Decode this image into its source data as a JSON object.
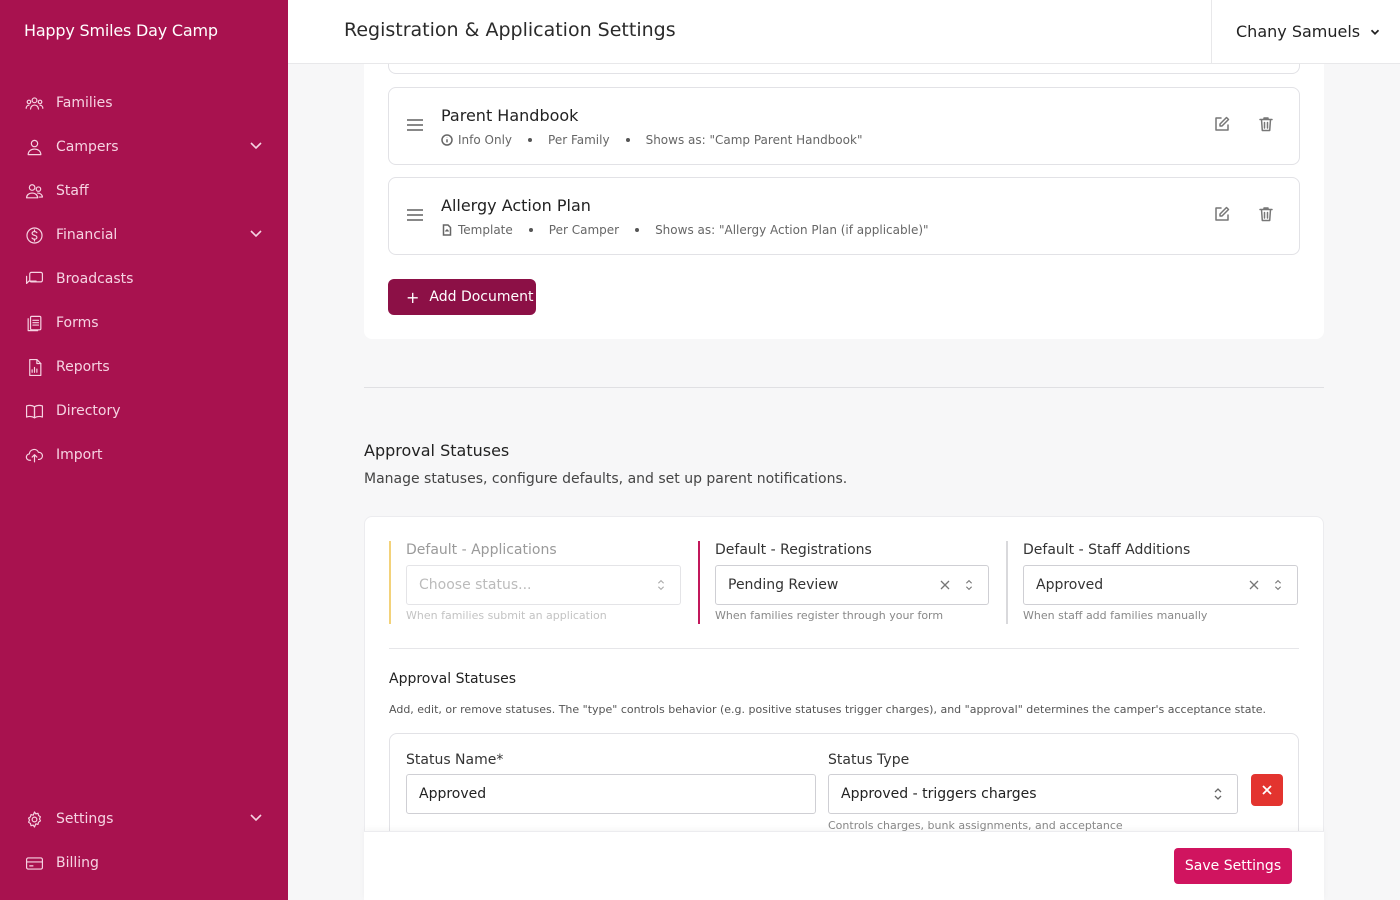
{
  "brand": {
    "name": "Happy Smiles Day Camp",
    "accent": "#a8124f"
  },
  "sidebar": {
    "items": [
      {
        "label": "Families",
        "icon": "families-icon",
        "expandable": false
      },
      {
        "label": "Campers",
        "icon": "camper-icon",
        "expandable": true
      },
      {
        "label": "Staff",
        "icon": "staff-icon",
        "expandable": false
      },
      {
        "label": "Financial",
        "icon": "dollar-icon",
        "expandable": true
      },
      {
        "label": "Broadcasts",
        "icon": "chat-icon",
        "expandable": false
      },
      {
        "label": "Forms",
        "icon": "forms-icon",
        "expandable": false
      },
      {
        "label": "Reports",
        "icon": "report-icon",
        "expandable": false
      },
      {
        "label": "Directory",
        "icon": "book-icon",
        "expandable": false
      },
      {
        "label": "Import",
        "icon": "upload-cloud-icon",
        "expandable": false
      }
    ],
    "bottom_items": [
      {
        "label": "Settings",
        "icon": "gear-icon",
        "expandable": true
      },
      {
        "label": "Billing",
        "icon": "card-icon",
        "expandable": false
      }
    ]
  },
  "header": {
    "title": "Registration & Application Settings",
    "user_name": "Chany Samuels"
  },
  "documents": [
    {
      "title": "Parent Handbook",
      "type_icon": "info-icon",
      "type": "Info Only",
      "scope": "Per Family",
      "shows_as": "Shows as: \"Camp Parent Handbook\""
    },
    {
      "title": "Allergy Action Plan",
      "type_icon": "file-icon",
      "type": "Template",
      "scope": "Per Camper",
      "shows_as": "Shows as: \"Allergy Action Plan (if applicable)\""
    }
  ],
  "add_document_label": "Add Document",
  "approval": {
    "title": "Approval Statuses",
    "subtitle": "Manage statuses, configure defaults, and set up parent notifications.",
    "defaults": [
      {
        "label": "Default - Applications",
        "value": "",
        "placeholder": "Choose status...",
        "hint": "When families submit an application",
        "disabled": true,
        "bar_color": "#f3d27a"
      },
      {
        "label": "Default - Registrations",
        "value": "Pending Review",
        "placeholder": "",
        "hint": "When families register through your form",
        "disabled": false,
        "bar_color": "#c2185b"
      },
      {
        "label": "Default - Staff Additions",
        "value": "Approved",
        "placeholder": "",
        "hint": "When staff add families manually",
        "disabled": false,
        "bar_color": "#d9d9dc"
      }
    ],
    "statuses_title": "Approval Statuses",
    "statuses_desc": "Add, edit, or remove statuses. The \"type\" controls behavior (e.g. positive statuses trigger charges), and \"approval\" determines the camper's acceptance state.",
    "status_row": {
      "name_label": "Status Name*",
      "name_value": "Approved",
      "type_label": "Status Type",
      "type_value": "Approved - triggers charges",
      "type_hint": "Controls charges, bunk assignments, and acceptance"
    }
  },
  "save_label": "Save Settings",
  "colors": {
    "save": "#d0145f",
    "add": "#8c1046",
    "remove": "#e3342f"
  }
}
